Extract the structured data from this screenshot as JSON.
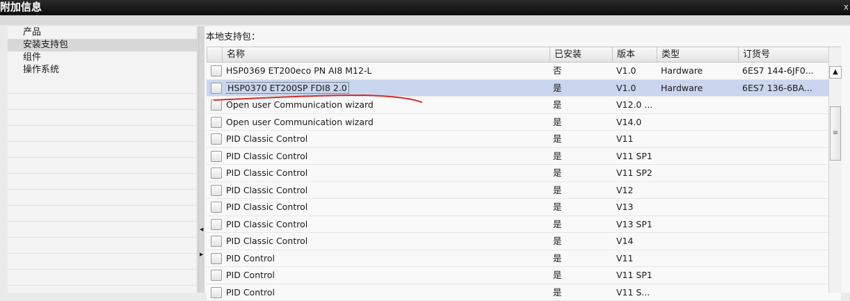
{
  "window": {
    "title": "附加信息",
    "close_glyph": "x"
  },
  "left_nav": {
    "items": [
      {
        "label": "产品",
        "selected": false
      },
      {
        "label": "安装支持包",
        "selected": true
      },
      {
        "label": "组件",
        "selected": false
      },
      {
        "label": "操作系统",
        "selected": false
      }
    ]
  },
  "main": {
    "label": "本地支持包：",
    "columns": {
      "name": "名称",
      "installed": "已安装",
      "version": "版本",
      "type": "类型",
      "order": "订货号"
    },
    "rows": [
      {
        "name": "HSP0369 ET200eco PN AI8 M12-L",
        "installed": "否",
        "version": "V1.0",
        "type": "Hardware",
        "order": "6ES7 144-6JF0...",
        "selected": false
      },
      {
        "name": "HSP0370 ET200SP FDI8 2.0",
        "installed": "是",
        "version": "V1.0",
        "type": "Hardware",
        "order": "6ES7 136-6BA...",
        "selected": true
      },
      {
        "name": "Open user Communication wizard",
        "installed": "是",
        "version": "V12.0 ...",
        "type": "",
        "order": "",
        "selected": false
      },
      {
        "name": "Open user Communication wizard",
        "installed": "是",
        "version": "V14.0",
        "type": "",
        "order": "",
        "selected": false
      },
      {
        "name": "PID Classic Control",
        "installed": "是",
        "version": "V11",
        "type": "",
        "order": "",
        "selected": false
      },
      {
        "name": "PID Classic Control",
        "installed": "是",
        "version": "V11 SP1",
        "type": "",
        "order": "",
        "selected": false
      },
      {
        "name": "PID Classic Control",
        "installed": "是",
        "version": "V11 SP2",
        "type": "",
        "order": "",
        "selected": false
      },
      {
        "name": "PID Classic Control",
        "installed": "是",
        "version": "V12",
        "type": "",
        "order": "",
        "selected": false
      },
      {
        "name": "PID Classic Control",
        "installed": "是",
        "version": "V13",
        "type": "",
        "order": "",
        "selected": false
      },
      {
        "name": "PID Classic Control",
        "installed": "是",
        "version": "V13 SP1",
        "type": "",
        "order": "",
        "selected": false
      },
      {
        "name": "PID Classic Control",
        "installed": "是",
        "version": "V14",
        "type": "",
        "order": "",
        "selected": false
      },
      {
        "name": "PID Control",
        "installed": "是",
        "version": "V11",
        "type": "",
        "order": "",
        "selected": false
      },
      {
        "name": "PID Control",
        "installed": "是",
        "version": "V11 SP1",
        "type": "",
        "order": "",
        "selected": false
      },
      {
        "name": "PID Control",
        "installed": "是",
        "version": "V11 S...",
        "type": "",
        "order": "",
        "selected": false
      }
    ]
  },
  "icons": {
    "scroll_up": "chevron-up-icon",
    "scroll_thumb": "grip-icon",
    "splitter_left": "arrow-left-icon",
    "splitter_right": "arrow-right-icon"
  },
  "colors": {
    "selection": "#c9d6ee",
    "annotation_line": "#d42a2a",
    "titlebar": "#111111"
  }
}
